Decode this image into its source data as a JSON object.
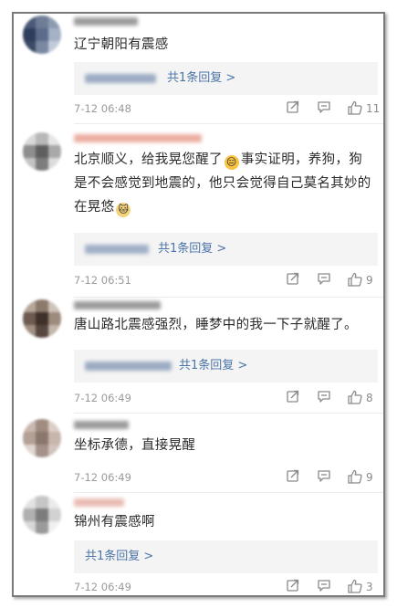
{
  "colors": {
    "link": "#4b74a8",
    "text": "#2b2b2b",
    "meta": "#9a9a9a",
    "reply_bg": "#f4f4f4"
  },
  "comments": [
    {
      "text": "辽宁朝阳有震感",
      "reply_label": "共1条回复 >",
      "time": "7-12 06:48",
      "likes": "11"
    },
    {
      "text_part1": "北京顺义，给我晃您醒了",
      "emoji1": "😑",
      "text_part2": "事实证明，养狗，狗是不会感觉到地震的，他只会觉得自己莫名其妙的在晃悠",
      "emoji2": "🐱",
      "reply_label": "共1条回复 >",
      "time": "7-12 06:51",
      "likes": "9"
    },
    {
      "text": "唐山路北震感强烈，睡梦中的我一下子就醒了。",
      "reply_label": "共1条回复 >",
      "time": "7-12 06:49",
      "likes": "8"
    },
    {
      "text": "坐标承德，直接晃醒",
      "time": "7-12 06:49",
      "likes": "9"
    },
    {
      "text": "锦州有震感啊",
      "reply_label": "共1条回复 >",
      "time": "7-12 06:49",
      "likes": "3"
    }
  ]
}
